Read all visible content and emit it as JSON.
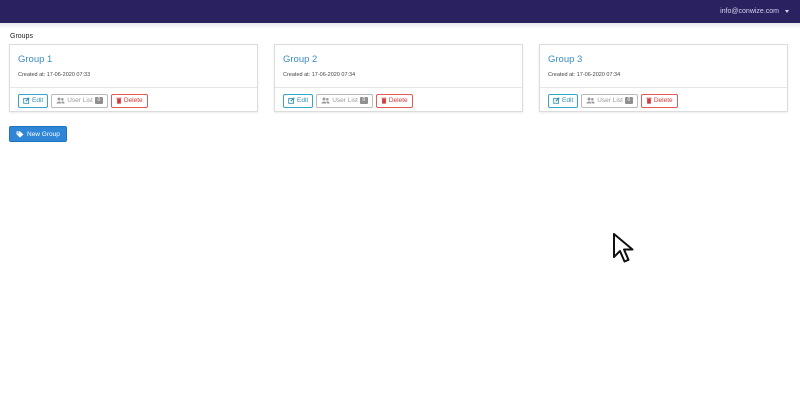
{
  "colors": {
    "brand": "#2a2160",
    "link": "#3a8cc1",
    "primary": "#2f86d6"
  },
  "header": {
    "user_email": "info@conwize.com"
  },
  "page": {
    "title": "Groups"
  },
  "groups": [
    {
      "title": "Group 1",
      "created": "Created at: 17-06-2020 07:33",
      "edit_label": "Edit",
      "users_label": "User List",
      "user_count": "0",
      "delete_label": "Delete"
    },
    {
      "title": "Group 2",
      "created": "Created at: 17-06-2020 07:34",
      "edit_label": "Edit",
      "users_label": "User List",
      "user_count": "0",
      "delete_label": "Delete"
    },
    {
      "title": "Group 3",
      "created": "Created at: 17-06-2020 07:34",
      "edit_label": "Edit",
      "users_label": "User List",
      "user_count": "0",
      "delete_label": "Delete"
    }
  ],
  "actions": {
    "new_group_label": "New Group"
  },
  "icons": {
    "edit": "edit-icon",
    "users": "users-icon",
    "delete": "trash-icon",
    "new_group": "tag-icon",
    "cursor": "mouse-pointer-icon"
  }
}
